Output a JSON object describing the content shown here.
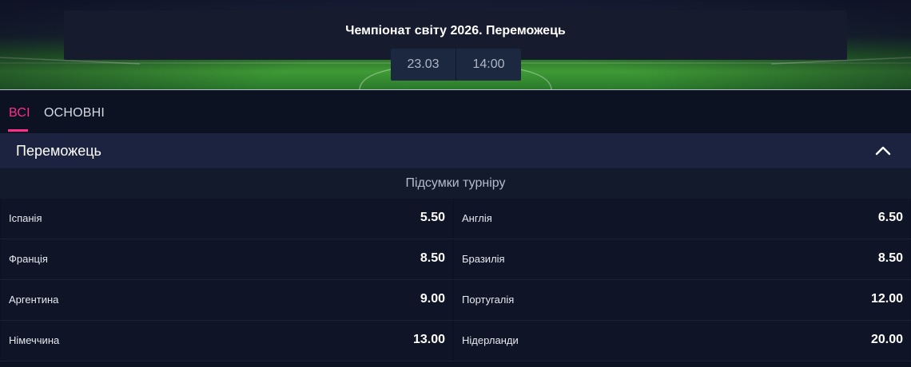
{
  "event": {
    "title": "Чемпіонат світу 2026. Переможець",
    "date": "23.03",
    "time": "14:00"
  },
  "tabs": [
    {
      "label": "ВСІ",
      "active": true
    },
    {
      "label": "ОСНОВНІ",
      "active": false
    }
  ],
  "market": {
    "name": "Переможець",
    "collapse_icon": "chevron-up-icon",
    "section_title": "Підсумки турніру",
    "rows": [
      [
        {
          "team": "Іспанія",
          "odd": "5.50"
        },
        {
          "team": "Англія",
          "odd": "6.50"
        }
      ],
      [
        {
          "team": "Франція",
          "odd": "8.50"
        },
        {
          "team": "Бразилія",
          "odd": "8.50"
        }
      ],
      [
        {
          "team": "Аргентина",
          "odd": "9.00"
        },
        {
          "team": "Португалія",
          "odd": "12.00"
        }
      ],
      [
        {
          "team": "Німеччина",
          "odd": "13.00"
        },
        {
          "team": "Нідерланди",
          "odd": "20.00"
        }
      ]
    ]
  },
  "colors": {
    "accent": "#ff2e8a",
    "background": "#0d1222",
    "header_bg": "#1b2340",
    "cell_bg": "#0f1526"
  }
}
